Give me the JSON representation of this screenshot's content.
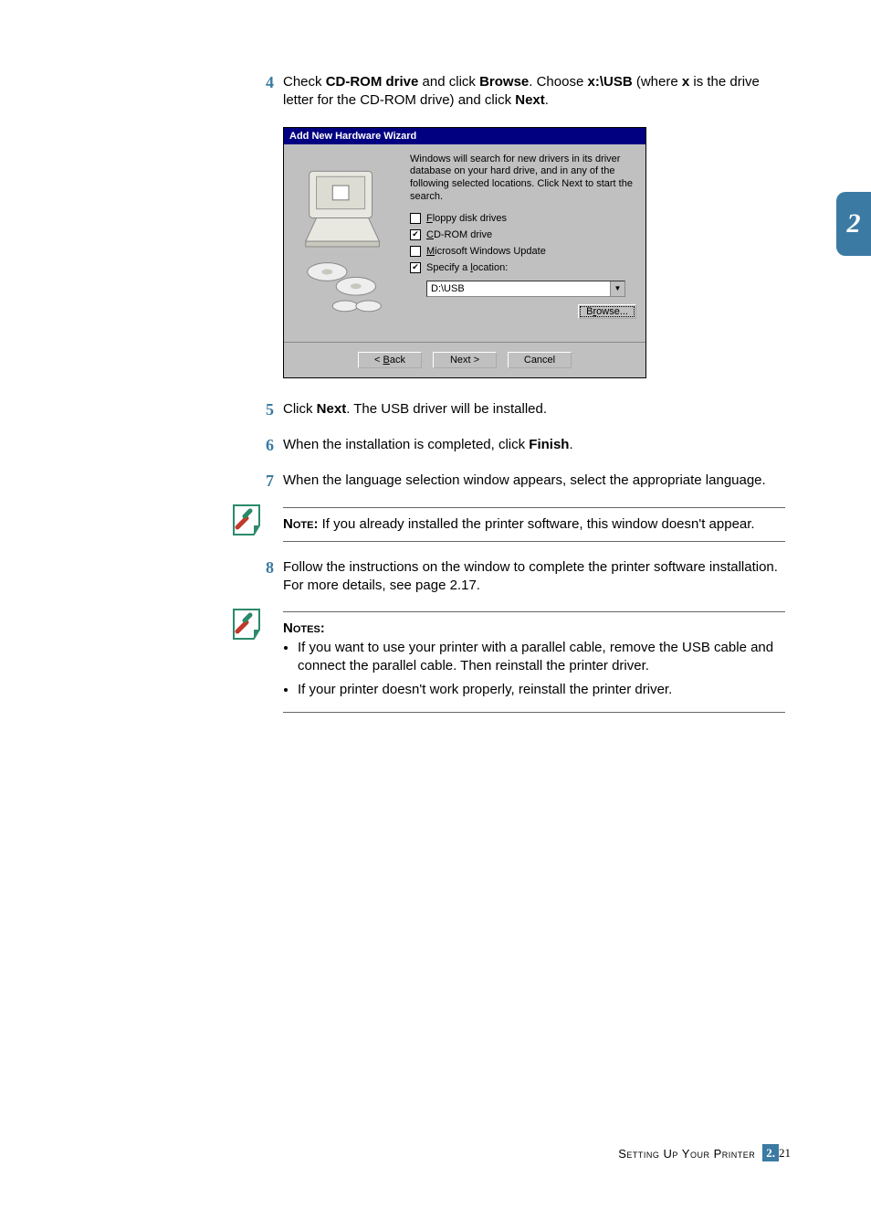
{
  "chapter_tab": "2",
  "steps": {
    "s4": {
      "num": "4",
      "pre": "Check ",
      "b1": "CD-ROM drive",
      "mid1": " and click ",
      "b2": "Browse",
      "mid2": ". Choose ",
      "b3": "x:\\USB",
      "mid3": " (where ",
      "b4": "x",
      "mid4": " is the drive letter for the CD-ROM drive) and click ",
      "b5": "Next",
      "end": "."
    },
    "s5": {
      "num": "5",
      "pre": "Click ",
      "b1": "Next",
      "post": ". The USB driver will be installed."
    },
    "s6": {
      "num": "6",
      "pre": "When the installation is completed, click ",
      "b1": "Finish",
      "post": "."
    },
    "s7": {
      "num": "7",
      "text": "When the language selection window appears, select the appropriate language."
    },
    "s8": {
      "num": "8",
      "text": "Follow the instructions on the window to complete the printer software installation. For more details, see page 2.17."
    }
  },
  "wizard": {
    "title": "Add New Hardware Wizard",
    "desc": "Windows will search for new drivers in its driver database on your hard drive, and in any of the following selected locations. Click Next to start the search.",
    "opts": {
      "floppy": {
        "checked": false,
        "ul": "F",
        "rest": "loppy disk drives"
      },
      "cdrom": {
        "checked": true,
        "ul": "C",
        "rest": "D-ROM drive"
      },
      "msupd": {
        "checked": false,
        "ul": "M",
        "rest": "icrosoft Windows Update"
      },
      "spec": {
        "checked": true,
        "pre": "Specify a ",
        "ul": "l",
        "rest": "ocation:"
      }
    },
    "location": "D:\\USB",
    "browse": "Browse...",
    "browse_ul": "r",
    "buttons": {
      "back_pre": "< ",
      "back_ul": "B",
      "back_rest": "ack",
      "next": "Next >",
      "cancel": "Cancel"
    }
  },
  "note1": {
    "label": "Note:",
    "text": " If you already installed the printer software, this window doesn't appear."
  },
  "note2": {
    "label": "Notes:",
    "items": [
      "If you want to use your printer with a parallel cable, remove the USB cable and connect the parallel cable. Then reinstall the printer driver.",
      "If your printer doesn't work properly, reinstall the printer driver."
    ]
  },
  "footer": {
    "section": "Setting Up Your Printer",
    "chap": "2.",
    "page": "21"
  }
}
